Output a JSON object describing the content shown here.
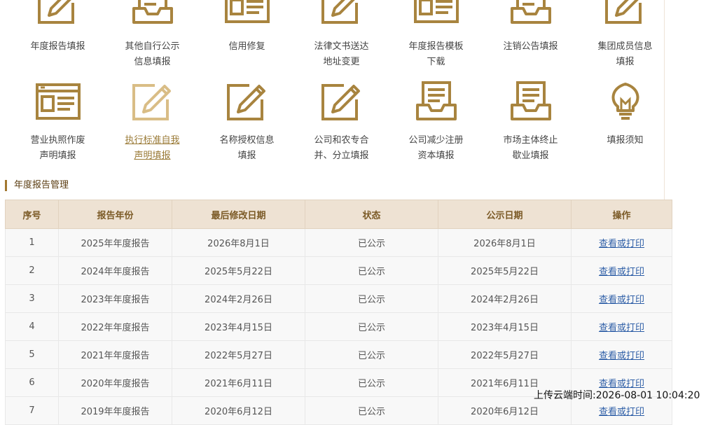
{
  "tiles_row1": [
    {
      "lines": [
        "年度报告填报"
      ],
      "icon": "edit-pen-icon"
    },
    {
      "lines": [
        "其他自行公示",
        "信息填报"
      ],
      "icon": "inbox-tray-icon"
    },
    {
      "lines": [
        "信用修复"
      ],
      "icon": "document-browser-icon"
    },
    {
      "lines": [
        "法律文书送达",
        "地址变更"
      ],
      "icon": "edit-pen-icon"
    },
    {
      "lines": [
        "年度报告模板",
        "下载"
      ],
      "icon": "document-browser-icon"
    },
    {
      "lines": [
        "注销公告填报"
      ],
      "icon": "inbox-tray-icon"
    },
    {
      "lines": [
        "集团成员信息",
        "填报"
      ],
      "icon": "edit-pen-icon"
    }
  ],
  "tiles_row2": [
    {
      "lines": [
        "营业执照作废",
        "声明填报"
      ],
      "icon": "document-browser-icon"
    },
    {
      "lines": [
        "执行标准自我",
        "声明填报"
      ],
      "icon": "edit-pen-icon"
    },
    {
      "lines": [
        "名称授权信息",
        "填报"
      ],
      "icon": "edit-pen-icon"
    },
    {
      "lines": [
        "公司和农专合",
        "并、分立填报"
      ],
      "icon": "edit-pen-icon"
    },
    {
      "lines": [
        "公司减少注册",
        "资本填报"
      ],
      "icon": "inbox-tray-icon"
    },
    {
      "lines": [
        "市场主体终止",
        "歇业填报"
      ],
      "icon": "inbox-tray-icon"
    },
    {
      "lines": [
        "填报须知"
      ],
      "icon": "lightbulb-icon"
    }
  ],
  "section_title": "年度报告管理",
  "table": {
    "headers": [
      "序号",
      "报告年份",
      "最后修改日期",
      "状态",
      "公示日期",
      "操作"
    ],
    "rows": [
      [
        "1",
        "2025年年度报告",
        "2026年8月1日",
        "已公示",
        "2026年8月1日",
        "查看或打印"
      ],
      [
        "2",
        "2024年年度报告",
        "2025年5月22日",
        "已公示",
        "2025年5月22日",
        "查看或打印"
      ],
      [
        "3",
        "2023年年度报告",
        "2024年2月26日",
        "已公示",
        "2024年2月26日",
        "查看或打印"
      ],
      [
        "4",
        "2022年年度报告",
        "2023年4月15日",
        "已公示",
        "2023年4月15日",
        "查看或打印"
      ],
      [
        "5",
        "2021年年度报告",
        "2022年5月27日",
        "已公示",
        "2022年5月27日",
        "查看或打印"
      ],
      [
        "6",
        "2020年年度报告",
        "2021年6月11日",
        "已公示",
        "2021年6月11日",
        "查看或打印"
      ],
      [
        "7",
        "2019年年度报告",
        "2020年6月12日",
        "已公示",
        "2020年6月12日",
        "查看或打印"
      ]
    ]
  },
  "upload_stamp": "上传云端时间:2026-08-01 10:04:20",
  "colors": {
    "gold": "#a8843f",
    "gold_light": "#d9bd86",
    "link": "#2f5fa7",
    "header_bg": "#eee2d3"
  }
}
